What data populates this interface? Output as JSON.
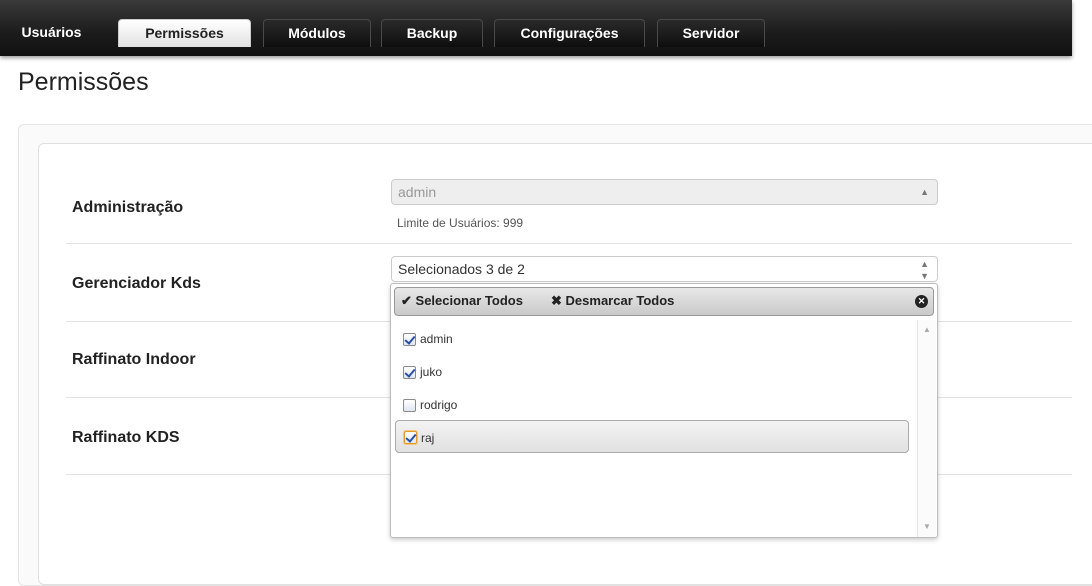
{
  "nav": {
    "tabs": [
      {
        "label": "Usuários",
        "active": false
      },
      {
        "label": "Permissões",
        "active": true
      },
      {
        "label": "Módulos",
        "active": false
      },
      {
        "label": "Backup",
        "active": false
      },
      {
        "label": "Configurações",
        "active": false
      },
      {
        "label": "Servidor",
        "active": false
      }
    ]
  },
  "page": {
    "title": "Permissões"
  },
  "rows": [
    {
      "label": "Administração"
    },
    {
      "label": "Gerenciador Kds"
    },
    {
      "label": "Raffinato Indoor"
    },
    {
      "label": "Raffinato KDS"
    }
  ],
  "administracao": {
    "select_value": "admin",
    "help": "Limite de Usuários: 999"
  },
  "kds": {
    "select_value": "Selecionados 3 de 2",
    "select_all": "Selecionar Todos",
    "deselect_all": "Desmarcar Todos",
    "options": [
      {
        "label": "admin",
        "checked": true
      },
      {
        "label": "juko",
        "checked": true
      },
      {
        "label": "rodrigo",
        "checked": false
      },
      {
        "label": "raj",
        "checked": true
      }
    ]
  },
  "icons": {
    "select_arrow": "select-arrows-icon",
    "check": "check-icon",
    "cross": "cross-icon",
    "close": "close-circle-icon"
  },
  "colors": {
    "nav_bg": "#1b1b1b",
    "active_tab_bg": "#ffffff",
    "checkbox_mark": "#2a4fa8",
    "focus_ring": "#e59a2c"
  }
}
